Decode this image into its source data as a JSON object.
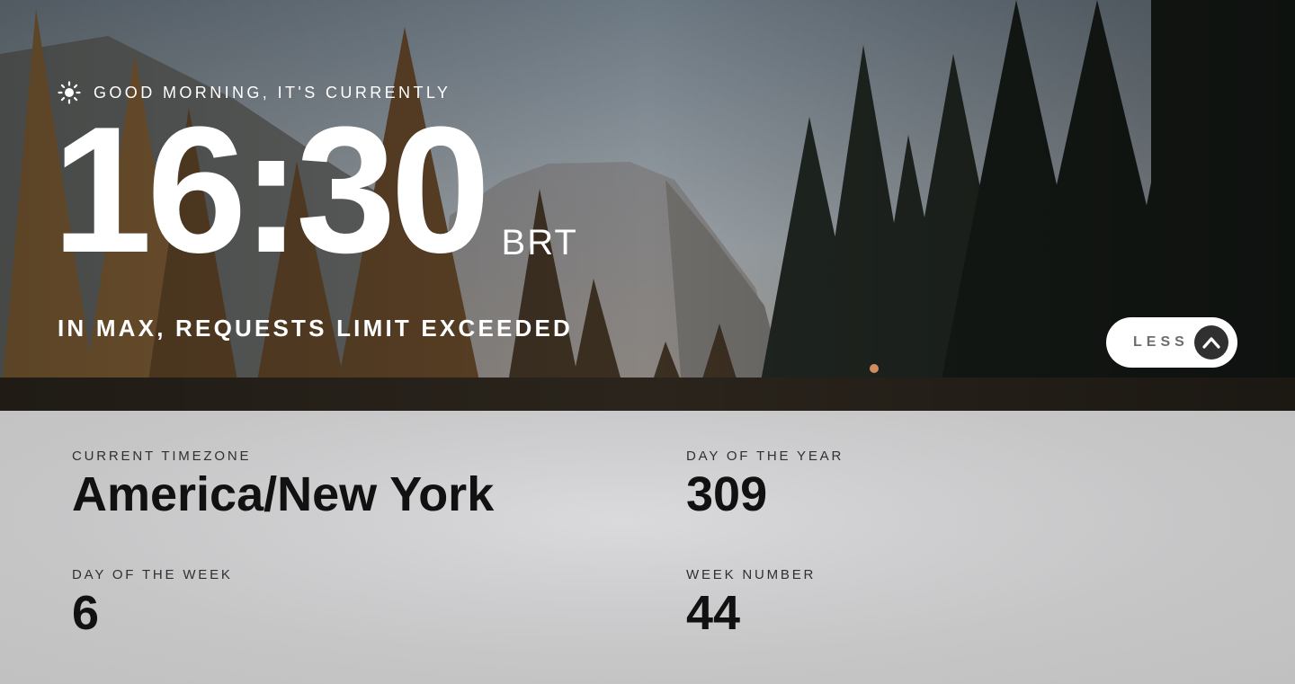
{
  "greeting": {
    "text": "GOOD MORNING, IT'S CURRENTLY",
    "icon": "sun-icon"
  },
  "clock": {
    "time": "16:30",
    "zone": "BRT"
  },
  "quote": {
    "text": "IN MAX, REQUESTS LIMIT EXCEEDED"
  },
  "toggle": {
    "label": "LESS",
    "icon": "chevron-up-icon"
  },
  "details": {
    "timezone": {
      "label": "CURRENT TIMEZONE",
      "value": "America/New York"
    },
    "day_of_year": {
      "label": "DAY OF THE YEAR",
      "value": "309"
    },
    "day_of_week": {
      "label": "DAY OF THE WEEK",
      "value": "6"
    },
    "week_number": {
      "label": "WEEK NUMBER",
      "value": "44"
    }
  },
  "colors": {
    "text_light": "#ffffff",
    "text_dark": "#303030",
    "panel_bg": "#c9c9ca",
    "button_bg": "#ffffff",
    "arrow_bg": "#303030"
  }
}
